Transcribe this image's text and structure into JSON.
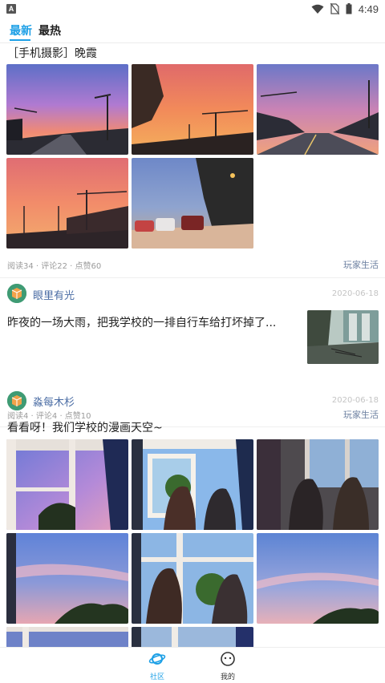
{
  "status_bar": {
    "app_icon_letter": "A",
    "time": "4:49"
  },
  "tabs": [
    {
      "label": "最新",
      "active": true
    },
    {
      "label": "最热",
      "active": false
    }
  ],
  "posts": [
    {
      "title": "［手机摄影］晚霞",
      "image_count": 5,
      "stats": "阅读34 · 评论22 · 点赞60",
      "tag": "玩家生活"
    },
    {
      "user": "眼里有光",
      "date": "2020-06-18",
      "text": "昨夜的一场大雨，把我学校的一排自行车给打坏掉了...",
      "stats": "阅读4 · 评论4 · 点赞10",
      "tag": "玩家生活"
    },
    {
      "user": "淼每木杉",
      "date": "2020-06-18",
      "text": "看看呀！我们学校的漫画天空~"
    }
  ],
  "bottom_nav": [
    {
      "label": "社区",
      "icon": "planet-icon",
      "active": true
    },
    {
      "label": "我的",
      "icon": "smiley-face-icon",
      "active": false
    }
  ],
  "colors": {
    "accent": "#1ea0e6",
    "username": "#4a6ca4",
    "tag": "#6b7fa0"
  }
}
